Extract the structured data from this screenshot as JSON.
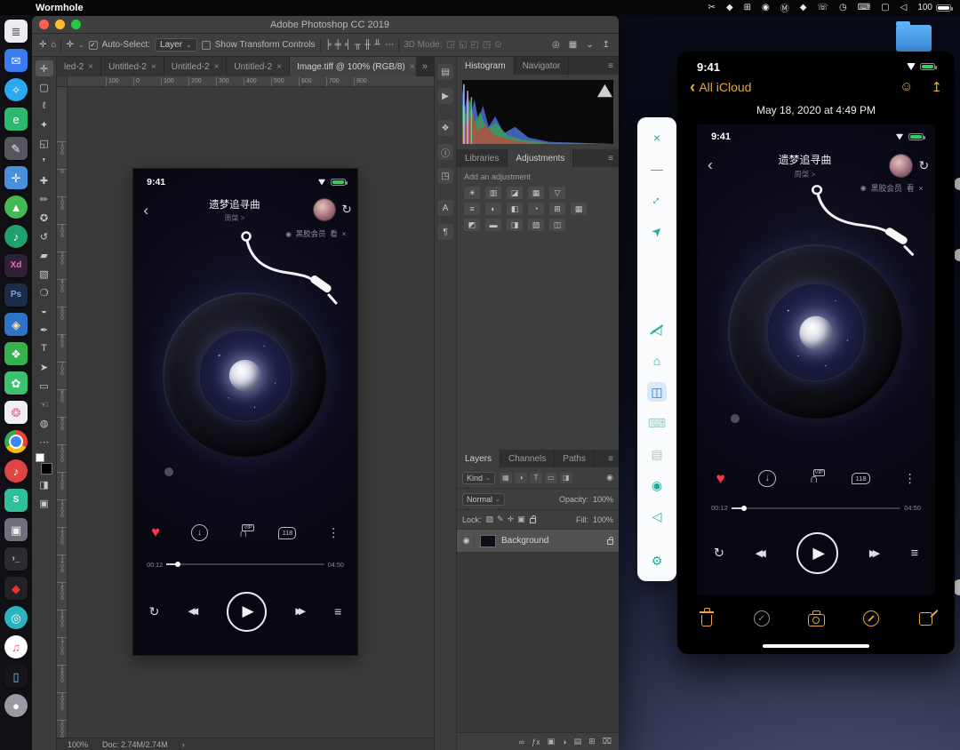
{
  "menubar": {
    "app_name": "Wormhole",
    "battery_percent": "100",
    "icons": [
      {
        "name": "scissors-icon",
        "glyph": "✂"
      },
      {
        "name": "notch-icon",
        "glyph": "◆"
      },
      {
        "name": "grid-icon",
        "glyph": "⊞"
      },
      {
        "name": "record-icon",
        "glyph": "◉"
      },
      {
        "name": "m-circle-icon",
        "glyph": "Ⓜ"
      },
      {
        "name": "bell-icon",
        "glyph": "◆"
      },
      {
        "name": "phone-icon",
        "glyph": "☏"
      },
      {
        "name": "clock-icon",
        "glyph": "◷"
      },
      {
        "name": "keyboard-icon",
        "glyph": "⌨"
      },
      {
        "name": "display-icon",
        "glyph": "▢"
      },
      {
        "name": "volume-icon",
        "glyph": "◁"
      }
    ]
  },
  "dock": {
    "items": [
      {
        "name": "dock-notes",
        "color": "#ececf0",
        "fg": "#555555",
        "glyph": "≣"
      },
      {
        "name": "dock-mail",
        "color": "#3a7bf0",
        "fg": "#ffffff",
        "glyph": "✉"
      },
      {
        "name": "dock-safari",
        "color": "#2aa8f2",
        "fg": "#ffffff",
        "glyph": "✧",
        "circle": true
      },
      {
        "name": "dock-evernote",
        "color": "#2db870",
        "fg": "#ffffff",
        "glyph": "e"
      },
      {
        "name": "dock-draw-app",
        "color": "#56565e",
        "fg": "#eeeeee",
        "glyph": "✎"
      },
      {
        "name": "dock-xcode",
        "color": "#4a8fd9",
        "fg": "#ffffff",
        "glyph": "✛"
      },
      {
        "name": "dock-green-circle-app",
        "color": "#46b954",
        "fg": "#ffffff",
        "glyph": "▲",
        "circle": true
      },
      {
        "name": "dock-podcasts",
        "color": "#1fa06c",
        "fg": "#ffffff",
        "glyph": "♪",
        "circle": true
      },
      {
        "name": "dock-adobe-xd",
        "color": "#2e2133",
        "fg": "#ef6bc2",
        "glyph": "Xd",
        "small": true
      },
      {
        "name": "dock-photoshop",
        "color": "#1c2b47",
        "fg": "#64b1ff",
        "glyph": "Ps",
        "small": true
      },
      {
        "name": "dock-blue-tool",
        "color": "#2f73c9",
        "fg": "#ffe9a8",
        "glyph": "◈"
      },
      {
        "name": "dock-wechat",
        "color": "#35b24e",
        "fg": "#ffffff",
        "glyph": "❖"
      },
      {
        "name": "dock-youdao",
        "color": "#3ec16e",
        "fg": "#ffffff",
        "glyph": "✿"
      },
      {
        "name": "dock-pinwheel",
        "color": "#f0f0f4",
        "fg": "#e0619a",
        "glyph": "❂"
      },
      {
        "name": "dock-chrome",
        "chrome": true,
        "circle": true
      },
      {
        "name": "dock-netease-music",
        "color": "#e04545",
        "fg": "#ffffff",
        "glyph": "♪",
        "circle": true
      },
      {
        "name": "dock-wormhole",
        "color": "#2fbf9a",
        "fg": "#ffffff",
        "glyph": "S",
        "small": true
      },
      {
        "name": "dock-gray-app",
        "color": "#70707a",
        "fg": "#eeeeee",
        "glyph": "▣"
      },
      {
        "name": "dock-terminal",
        "color": "#2b2b30",
        "fg": "#9fe89f",
        "glyph": "›_",
        "small": true
      },
      {
        "name": "dock-dark-app",
        "color": "#222226",
        "fg": "#ee3333",
        "glyph": "◆"
      },
      {
        "name": "dock-teal-circle-app",
        "color": "#2bb3c0",
        "fg": "#ffffff",
        "glyph": "◎",
        "circle": true
      },
      {
        "name": "dock-music",
        "color": "#ffffff",
        "fg": "#f3506e",
        "glyph": "♫",
        "circle": true
      },
      {
        "name": "dock-iphone-app",
        "color": "#15151a",
        "fg": "#7fc8ff",
        "glyph": "▯"
      },
      {
        "name": "dock-gray-circle-app",
        "color": "#9a9aa2",
        "fg": "#ffffff",
        "glyph": "●",
        "circle": true
      }
    ]
  },
  "photoshop": {
    "title": "Adobe Photoshop CC 2019",
    "options": {
      "preset_glyph": "✛",
      "home_glyph": "⌂",
      "tool_glyph": "✛",
      "caret": "⌄",
      "check_glyph": "✓",
      "auto_select_label": "Auto-Select:",
      "auto_select_value": "Layer",
      "show_transform_label": "Show Transform Controls",
      "align_icons": [
        {
          "name": "align-left-icon",
          "glyph": "╞"
        },
        {
          "name": "align-center-h-icon",
          "glyph": "╪"
        },
        {
          "name": "align-right-icon",
          "glyph": "╡"
        },
        {
          "name": "align-top-icon",
          "glyph": "╥"
        },
        {
          "name": "align-middle-icon",
          "glyph": "╫"
        },
        {
          "name": "align-bottom-icon",
          "glyph": "╨"
        }
      ],
      "more_glyph": "⋯",
      "mode_label": "3D Mode:",
      "mode_icons": [
        {
          "name": "3d-orbit-icon",
          "glyph": "◲"
        },
        {
          "name": "3d-roll-icon",
          "glyph": "◱"
        },
        {
          "name": "3d-pan-icon",
          "glyph": "◰"
        },
        {
          "name": "3d-slide-icon",
          "glyph": "◳"
        },
        {
          "name": "3d-scale-icon",
          "glyph": "⊙"
        }
      ],
      "right_icons": [
        {
          "name": "search-icon",
          "glyph": "◎"
        },
        {
          "name": "workspace-icon",
          "glyph": "▦"
        },
        {
          "name": "workspace-caret-icon",
          "glyph": "⌄"
        },
        {
          "name": "share-icon",
          "glyph": "↥"
        }
      ]
    },
    "tabs": [
      {
        "label": "led-2",
        "close": "×"
      },
      {
        "label": "Untitled-2",
        "close": "×"
      },
      {
        "label": "Untitled-2",
        "close": "×"
      },
      {
        "label": "Untitled-2",
        "close": "×"
      },
      {
        "label": "Image.tiff @ 100% (RGB/8)",
        "close": "×",
        "active": true
      }
    ],
    "tab_overflow_glyph": "»",
    "ruler_h": [
      "100",
      "0",
      "100",
      "200",
      "300",
      "400",
      "500",
      "600",
      "700",
      "800"
    ],
    "ruler_v": [
      "100",
      "0",
      "100",
      "200",
      "300",
      "400",
      "500",
      "600",
      "700",
      "800",
      "900",
      "1000",
      "1100",
      "1200",
      "1300",
      "1400",
      "1500",
      "1600",
      "1700",
      "1800",
      "1900",
      "2000"
    ],
    "tools": [
      {
        "name": "move-tool",
        "glyph": "✛",
        "active": true
      },
      {
        "name": "marquee-tool",
        "glyph": "▢"
      },
      {
        "name": "lasso-tool",
        "glyph": "ℓ"
      },
      {
        "name": "quick-select-tool",
        "glyph": "✦"
      },
      {
        "name": "crop-tool",
        "glyph": "◱"
      },
      {
        "name": "eyedropper-tool",
        "glyph": "❜"
      },
      {
        "name": "healing-brush-tool",
        "glyph": "✚"
      },
      {
        "name": "brush-tool",
        "glyph": "✏"
      },
      {
        "name": "clone-stamp-tool",
        "glyph": "✪"
      },
      {
        "name": "history-brush-tool",
        "glyph": "↺"
      },
      {
        "name": "eraser-tool",
        "glyph": "▰"
      },
      {
        "name": "gradient-tool",
        "glyph": "▧"
      },
      {
        "name": "blur-tool",
        "glyph": "❍"
      },
      {
        "name": "dodge-tool",
        "glyph": "◒"
      },
      {
        "name": "pen-tool",
        "glyph": "✒"
      },
      {
        "name": "type-tool",
        "glyph": "T"
      },
      {
        "name": "path-select-tool",
        "glyph": "➤"
      },
      {
        "name": "shape-tool",
        "glyph": "▭"
      },
      {
        "name": "hand-tool",
        "glyph": "☜"
      },
      {
        "name": "zoom-tool",
        "glyph": "◍"
      },
      {
        "name": "edit-toolbar-icon",
        "glyph": "⋯"
      }
    ],
    "tools_bottom": [
      {
        "name": "quick-mask-icon",
        "glyph": "◨"
      },
      {
        "name": "screen-mode-icon",
        "glyph": "▣"
      }
    ],
    "collapsed_panels": [
      {
        "name": "brushes-panel-icon",
        "glyph": "▤"
      },
      {
        "name": "actions-panel-icon",
        "glyph": "▶"
      },
      {
        "name": "swatches-panel-icon",
        "glyph": "❖",
        "gap": true
      },
      {
        "name": "info-panel-icon",
        "glyph": "ⓘ"
      },
      {
        "name": "properties-panel-icon",
        "glyph": "◳"
      },
      {
        "name": "character-panel-icon",
        "glyph": "A",
        "gap": true
      },
      {
        "name": "paragraph-panel-icon",
        "glyph": "¶"
      }
    ],
    "histogram": {
      "tabs": [
        {
          "label": "Histogram",
          "active": true
        },
        {
          "label": "Navigator"
        }
      ],
      "menu_glyph": "≡"
    },
    "adjustments": {
      "tabs": [
        {
          "label": "Libraries"
        },
        {
          "label": "Adjustments",
          "active": true
        }
      ],
      "menu_glyph": "≡",
      "label": "Add an adjustment",
      "row1": [
        {
          "name": "brightness-contrast-icon",
          "glyph": "☀"
        },
        {
          "name": "levels-icon",
          "glyph": "▥"
        },
        {
          "name": "curves-icon",
          "glyph": "◪"
        },
        {
          "name": "exposure-icon",
          "glyph": "▦"
        },
        {
          "name": "vibrance-icon",
          "glyph": "▽"
        }
      ],
      "row2": [
        {
          "name": "hue-saturation-icon",
          "glyph": "≡"
        },
        {
          "name": "color-balance-icon",
          "glyph": "◐"
        },
        {
          "name": "black-white-icon",
          "glyph": "◧"
        },
        {
          "name": "photo-filter-icon",
          "glyph": "◔"
        },
        {
          "name": "channel-mixer-icon",
          "glyph": "⊞"
        },
        {
          "name": "color-lookup-icon",
          "glyph": "▦"
        }
      ],
      "row3": [
        {
          "name": "invert-icon",
          "glyph": "◩"
        },
        {
          "name": "posterize-icon",
          "glyph": "▬"
        },
        {
          "name": "threshold-icon",
          "glyph": "◨"
        },
        {
          "name": "gradient-map-icon",
          "glyph": "▧"
        },
        {
          "name": "selective-color-icon",
          "glyph": "◫"
        }
      ]
    },
    "layers": {
      "tabs": [
        {
          "label": "Layers",
          "active": true
        },
        {
          "label": "Channels"
        },
        {
          "label": "Paths"
        }
      ],
      "menu_glyph": "≡",
      "kind_label": "Kind",
      "caret": "⌄",
      "filter_icons": [
        {
          "name": "filter-pixel-icon",
          "glyph": "▦"
        },
        {
          "name": "filter-adjustment-icon",
          "glyph": "◑"
        },
        {
          "name": "filter-type-icon",
          "glyph": "T"
        },
        {
          "name": "filter-shape-icon",
          "glyph": "▭"
        },
        {
          "name": "filter-smart-icon",
          "glyph": "◨"
        }
      ],
      "filter_toggle_glyph": "◉",
      "blend_mode": "Normal",
      "opacity_label": "Opacity:",
      "opacity_value": "100%",
      "lock_label": "Lock:",
      "lock_icons": [
        {
          "name": "lock-transparency-icon",
          "glyph": "▨"
        },
        {
          "name": "lock-pixels-icon",
          "glyph": "✎"
        },
        {
          "name": "lock-position-icon",
          "glyph": "✛"
        },
        {
          "name": "lock-artboard-icon",
          "glyph": "▣"
        }
      ],
      "fill_label": "Fill:",
      "fill_value": "100%",
      "eye_glyph": "◉",
      "layer_name": "Background",
      "bottom_icons": [
        {
          "name": "link-layers-icon",
          "glyph": "∞"
        },
        {
          "name": "layer-effects-icon",
          "glyph": "ƒx"
        },
        {
          "name": "layer-mask-icon",
          "glyph": "▣"
        },
        {
          "name": "adjustment-layer-icon",
          "glyph": "◑"
        },
        {
          "name": "layer-group-icon",
          "glyph": "▤"
        },
        {
          "name": "new-layer-icon",
          "glyph": "⊞"
        },
        {
          "name": "delete-layer-icon",
          "glyph": "⌧"
        }
      ]
    },
    "statusbar": {
      "zoom": "100%",
      "doc": "Doc: 2.74M/2.74M",
      "chevron": "›"
    }
  },
  "player": {
    "status_time": "9:41",
    "back_glyph": "‹",
    "title": "遗梦追寻曲",
    "subtitle": "周棨 >",
    "refresh_glyph": "↻",
    "vip_icon_glyph": "◉",
    "vip_label": "黑胶会员",
    "vip_action": "看",
    "vip_close": "×",
    "heart_glyph": "♥",
    "download_glyph": "↓",
    "headset_glyph": "∩",
    "headset_badge": "VIP",
    "comment_count": "118",
    "more_glyph": "⋮",
    "time_current": "00:12",
    "time_total": "04:50",
    "loop_glyph": "↻",
    "prev_glyph": "◀◀",
    "play_glyph": "▶",
    "next_glyph": "▶▶",
    "queue_glyph": "≡"
  },
  "wormhole_toolbar": {
    "top": [
      {
        "name": "close-icon",
        "glyph": "×"
      },
      {
        "name": "minimize-icon",
        "glyph": "—"
      },
      {
        "name": "fullscreen-icon",
        "glyph": "↕",
        "rot45": true
      },
      {
        "name": "pin-icon",
        "glyph": "➤",
        "rot": true
      }
    ],
    "middle": [
      {
        "name": "mute-icon",
        "glyph": "◁",
        "slash": true
      },
      {
        "name": "home-icon",
        "glyph": "⌂"
      },
      {
        "name": "screen-mirror-icon",
        "glyph": "◫",
        "selected": true
      },
      {
        "name": "keyboard-icon",
        "glyph": "⌨",
        "dim": true
      },
      {
        "name": "file-transfer-icon",
        "glyph": "▤",
        "dim": true
      },
      {
        "name": "screenshot-icon",
        "glyph": "◉"
      },
      {
        "name": "volume-icon",
        "glyph": "◁"
      }
    ],
    "bottom": [
      {
        "name": "settings-icon",
        "glyph": "⚙"
      }
    ]
  },
  "phone": {
    "status_time": "9:41",
    "back_glyph": "‹",
    "back_label": "All iCloud",
    "nav_icons": [
      {
        "name": "add-people-icon",
        "glyph": "☺"
      },
      {
        "name": "share-icon",
        "glyph": "↥"
      }
    ],
    "date_label": "May 18, 2020 at 4:49 PM",
    "check_glyph": "✓",
    "toolbar_icons": [
      "trash-icon",
      "select-check-icon",
      "camera-icon",
      "markup-icon",
      "compose-icon"
    ]
  }
}
